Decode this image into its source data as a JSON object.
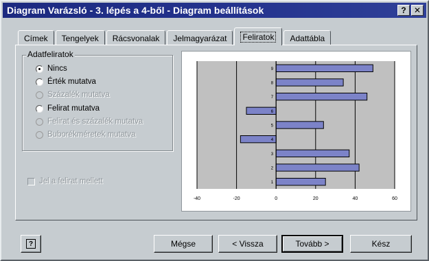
{
  "window": {
    "title": "Diagram Varázsló - 3. lépés a 4-ből - Diagram beállítások",
    "help_glyph": "?",
    "close_glyph": "✕"
  },
  "tabs": [
    {
      "label": "Címek",
      "active": false
    },
    {
      "label": "Tengelyek",
      "active": false
    },
    {
      "label": "Rácsvonalak",
      "active": false
    },
    {
      "label": "Jelmagyarázat",
      "active": false
    },
    {
      "label": "Feliratok",
      "active": true
    },
    {
      "label": "Adattábla",
      "active": false
    }
  ],
  "data_labels": {
    "group_title": "Adatfeliratok",
    "options": [
      {
        "label": "Nincs",
        "checked": true,
        "enabled": true
      },
      {
        "label": "Érték mutatva",
        "checked": false,
        "enabled": true
      },
      {
        "label": "Százalék mutatva",
        "checked": false,
        "enabled": false
      },
      {
        "label": "Felirat mutatva",
        "checked": false,
        "enabled": true
      },
      {
        "label": "Felirat és százalék mutatva",
        "checked": false,
        "enabled": false
      },
      {
        "label": "Buborékméretek mutatva",
        "checked": false,
        "enabled": false
      }
    ]
  },
  "legend_key": {
    "label": "Jel a felirat mellett",
    "checked": false,
    "enabled": false
  },
  "footer": {
    "help_glyph": "?",
    "cancel": "Mégse",
    "back": "< Vissza",
    "next": "Tovább >",
    "finish": "Kész"
  },
  "colors": {
    "titlebar": "#1c2a80",
    "bar_fill": "#7c83c8",
    "plot_bg": "#c0c0c0"
  },
  "chart_data": {
    "type": "bar",
    "orientation": "horizontal",
    "categories": [
      "1",
      "2",
      "3",
      "4",
      "5",
      "6",
      "7",
      "8",
      "9"
    ],
    "values": [
      25,
      42,
      37,
      -18,
      24,
      -15,
      46,
      34,
      49
    ],
    "xlim": [
      -40,
      60
    ],
    "x_ticks": [
      "-40",
      "-20",
      "0",
      "20",
      "40",
      "60"
    ],
    "grid": true,
    "title": "",
    "xlabel": "",
    "ylabel": ""
  }
}
